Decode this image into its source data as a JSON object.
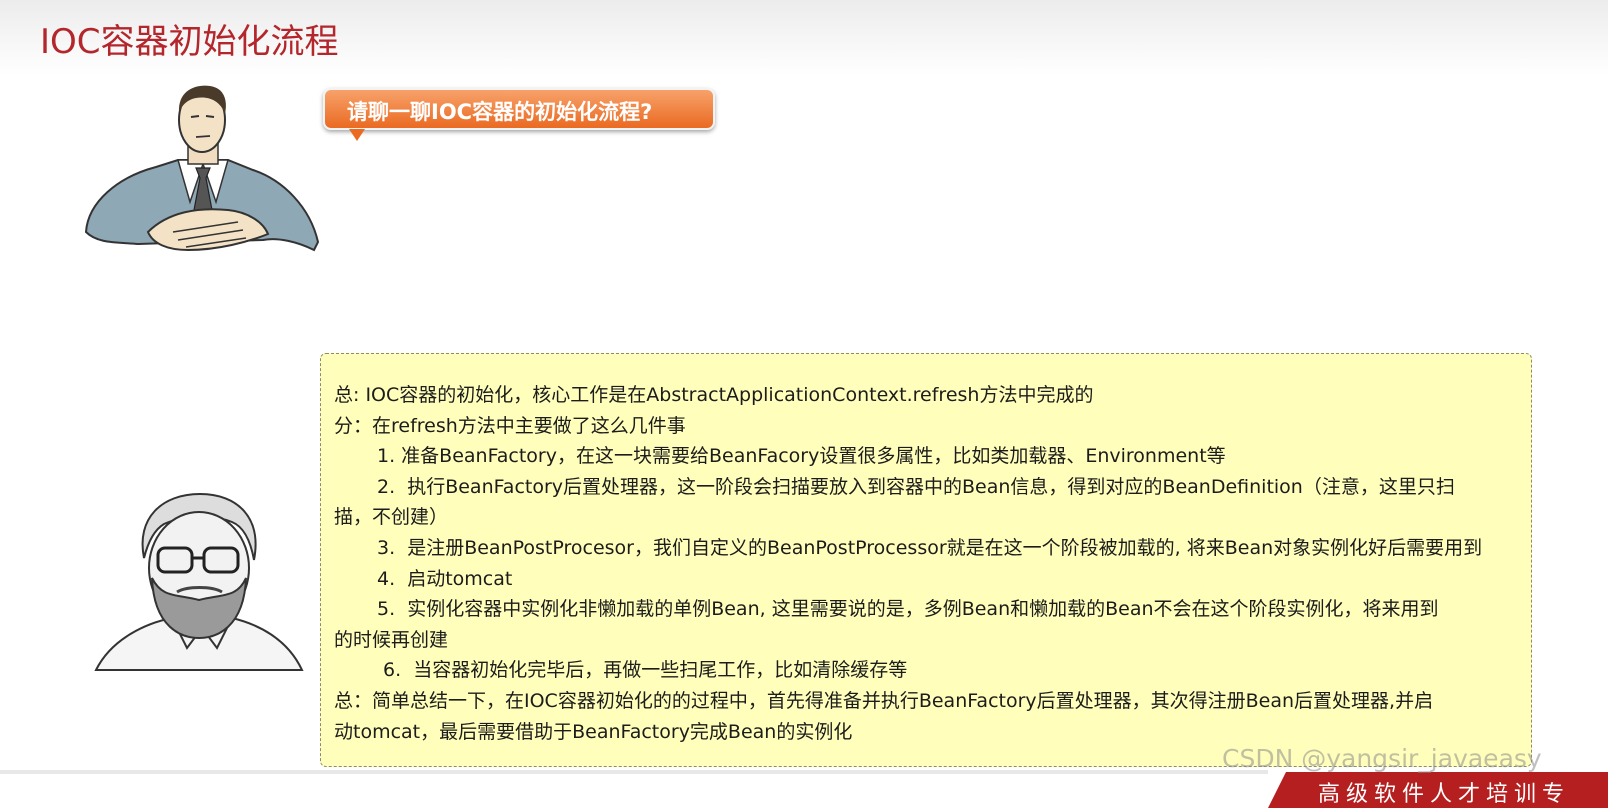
{
  "slide": {
    "title": "IOC容器初始化流程",
    "question": "请聊一聊IOC容器的初始化流程?"
  },
  "answer": {
    "lines": [
      "总: IOC容器的初始化，核心工作是在AbstractApplicationContext.refresh方法中完成的",
      "分：在refresh方法中主要做了这么几件事",
      "1. 准备BeanFactory，在这一块需要给BeanFacory设置很多属性，比如类加载器、Environment等",
      "2.  执行BeanFactory后置处理器，这一阶段会扫描要放入到容器中的Bean信息，得到对应的BeanDefinition（注意，这里只扫",
      "描，不创建）",
      "3.  是注册BeanPostProcesor，我们自定义的BeanPostProcessor就是在这一个阶段被加载的, 将来Bean对象实例化好后需要用到",
      "4.  启动tomcat",
      "5.  实例化容器中实例化非懒加载的单例Bean, 这里需要说的是，多例Bean和懒加载的Bean不会在这个阶段实例化，将来用到",
      "的时候再创建",
      "6.  当容器初始化完毕后，再做一些扫尾工作，比如清除缓存等",
      "总：简单总结一下，在IOC容器初始化的的过程中，首先得准备并执行BeanFactory后置处理器，其次得注册Bean后置处理器,并启",
      "动tomcat，最后需要借助于BeanFactory完成Bean的实例化"
    ]
  },
  "footer": {
    "watermark": "CSDN @yangsir_javaeasy",
    "banner": "高级软件人才培训专"
  },
  "colors": {
    "title": "#b3262b",
    "bubble": "#ea6a22",
    "answer_bg": "#ffffbb",
    "banner": "#b51f1f"
  },
  "icons": {
    "interviewer": "interviewer-illustration",
    "candidate": "bearded-man-illustration"
  }
}
